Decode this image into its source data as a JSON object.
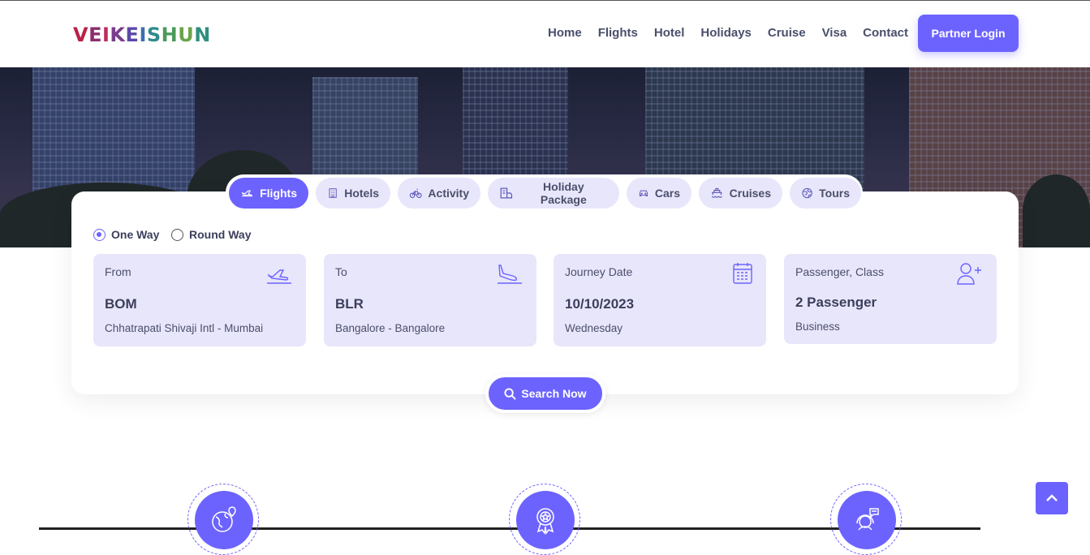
{
  "brand": {
    "logo_text": "VEIKEISHUN"
  },
  "nav": {
    "items": [
      "Home",
      "Flights",
      "Hotel",
      "Holidays",
      "Cruise",
      "Visa",
      "Contact"
    ],
    "partner_login": "Partner Login"
  },
  "tabs": [
    {
      "label": "Flights",
      "icon": "plane-icon",
      "active": true
    },
    {
      "label": "Hotels",
      "icon": "building-icon",
      "active": false
    },
    {
      "label": "Activity",
      "icon": "bicycle-icon",
      "active": false
    },
    {
      "label": "Holiday Package",
      "icon": "holiday-icon",
      "active": false
    },
    {
      "label": "Cars",
      "icon": "car-icon",
      "active": false
    },
    {
      "label": "Cruises",
      "icon": "ship-icon",
      "active": false
    },
    {
      "label": "Tours",
      "icon": "globe-icon",
      "active": false
    }
  ],
  "trip_type": {
    "one_way": "One Way",
    "round_way": "Round Way",
    "selected": "One Way"
  },
  "fields": {
    "from": {
      "label": "From",
      "code": "BOM",
      "detail": "Chhatrapati Shivaji Intl - Mumbai"
    },
    "to": {
      "label": "To",
      "code": "BLR",
      "detail": "Bangalore - Bangalore"
    },
    "date": {
      "label": "Journey Date",
      "value": "10/10/2023",
      "detail": "Wednesday"
    },
    "passenger": {
      "label": "Passenger, Class",
      "value": "2 Passenger",
      "detail": "Business"
    }
  },
  "search": {
    "label": "Search Now"
  },
  "colors": {
    "accent": "#6c63ff",
    "field_bg": "#e8e6fb",
    "text": "#3b3f5c"
  },
  "features": [
    "globe-location-icon",
    "award-badge-icon",
    "support-agent-icon"
  ]
}
